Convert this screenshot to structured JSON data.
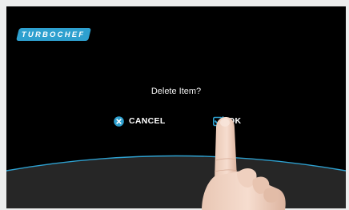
{
  "brand": {
    "logo_text": "TURBOCHEF"
  },
  "dialog": {
    "title": "Delete Item?",
    "cancel_label": "CANCEL",
    "ok_label": "OK",
    "cancel_icon": "close-circle-icon",
    "ok_icon": "checkbox-checked-icon"
  },
  "colors": {
    "screen_background": "#000000",
    "accent": "#2ea0cf",
    "bottom_panel": "#262626",
    "text": "#ffffff"
  }
}
